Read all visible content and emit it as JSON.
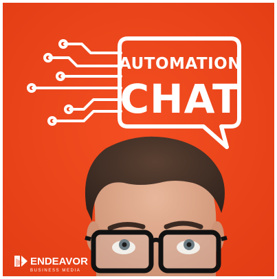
{
  "colors": {
    "background": "#f1461d",
    "background_edge": "#e03a12",
    "foreground": "#ffffff",
    "hair": "#3a2a22",
    "skin": "#d9a184"
  },
  "title": {
    "line1": "AUTOMATION",
    "line2": "CHAT"
  },
  "brand": {
    "name": "ENDEAVOR",
    "subtitle": "BUSINESS MEDIA",
    "logo_icon": "endeavor-logo-icon"
  },
  "icons": [
    "circuit-lines-icon",
    "speech-bubble-icon"
  ]
}
